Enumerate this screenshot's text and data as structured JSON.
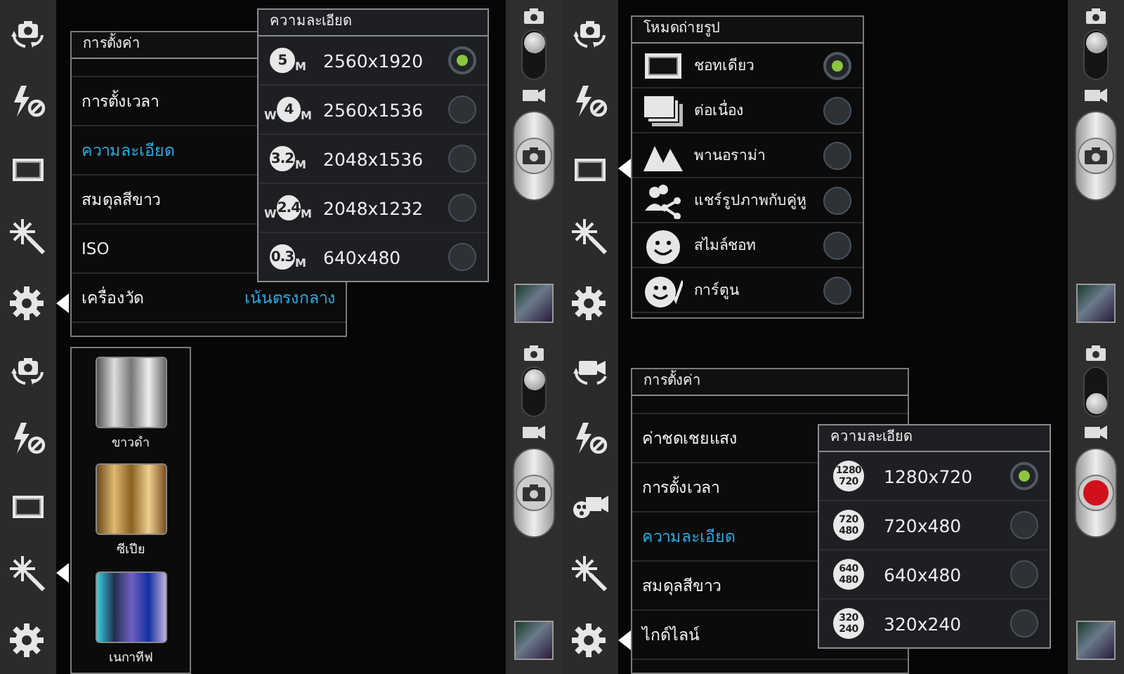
{
  "screens": [
    {
      "toolbar": [
        {
          "kind": "camera-switch",
          "selected": false
        },
        {
          "kind": "flash-off",
          "selected": false
        },
        {
          "kind": "single-shot",
          "selected": false
        },
        {
          "kind": "effects",
          "selected": false
        },
        {
          "kind": "settings",
          "selected": true
        }
      ],
      "settings_panel": {
        "title": "การตั้งค่า",
        "rows": [
          {
            "label": "การตั้งเวลา",
            "selected": false
          },
          {
            "label": "ความละเอียด",
            "selected": true
          },
          {
            "label": "สมดุลสีขาว",
            "selected": false
          },
          {
            "label": "ISO",
            "selected": false
          },
          {
            "label": "เครื่องวัด",
            "value": "เน้นตรงกลาง",
            "selected": false
          }
        ]
      },
      "popup": {
        "title": "ความละเอียด",
        "options": [
          {
            "badge": {
              "kind": "megapixel",
              "number": "5",
              "unit": "M"
            },
            "label": "2560x1920",
            "selected": true
          },
          {
            "badge": {
              "kind": "megapixel",
              "prefix": "W",
              "number": "4",
              "unit": "M"
            },
            "label": "2560x1536",
            "selected": false
          },
          {
            "badge": {
              "kind": "megapixel",
              "number": "3.2",
              "unit": "M"
            },
            "label": "2048x1536",
            "selected": false
          },
          {
            "badge": {
              "kind": "megapixel",
              "prefix": "W",
              "number": "2.4",
              "unit": "M"
            },
            "label": "2048x1232",
            "selected": false
          },
          {
            "badge": {
              "kind": "megapixel",
              "number": "0.3",
              "unit": "M"
            },
            "label": "640x480",
            "selected": false
          }
        ]
      }
    },
    {
      "left_rail": {
        "video": false
      },
      "toolbar": [
        {
          "kind": "camera-switch",
          "selected": false
        },
        {
          "kind": "flash-off",
          "selected": false
        },
        {
          "kind": "single-shot",
          "selected": true
        },
        {
          "kind": "effects",
          "selected": false
        },
        {
          "kind": "settings",
          "selected": false
        }
      ],
      "mode_panel": {
        "title": "โหมดถ่ายรูป",
        "options": [
          {
            "kind": "single",
            "label": "ชอทเดียว",
            "selected": true
          },
          {
            "kind": "continuous",
            "label": "ต่อเนื่อง",
            "selected": false
          },
          {
            "kind": "panorama",
            "label": "พานอราม่า",
            "selected": false
          },
          {
            "kind": "buddy-share",
            "label": "แชร์รูปภาพกับคู่หู",
            "selected": false
          },
          {
            "kind": "smile",
            "label": "สไมล์ชอท",
            "selected": false
          },
          {
            "kind": "cartoon",
            "label": "การ์ตูน",
            "selected": false
          }
        ]
      },
      "right_rail": {
        "video": false
      }
    },
    {
      "toolbar": [
        {
          "kind": "camera-switch",
          "selected": false
        },
        {
          "kind": "flash-off",
          "selected": false
        },
        {
          "kind": "single-shot",
          "selected": false
        },
        {
          "kind": "effects",
          "selected": true
        },
        {
          "kind": "settings",
          "selected": false
        }
      ],
      "effects_panel": {
        "items": [
          {
            "kind": "mono",
            "label": "ขาวดำ"
          },
          {
            "kind": "sepia",
            "label": "ซีเปีย"
          },
          {
            "kind": "negative",
            "label": "เนกาทีฟ"
          }
        ]
      }
    },
    {
      "left_rail": {
        "video": false
      },
      "toolbar": [
        {
          "kind": "video-switch",
          "selected": false
        },
        {
          "kind": "flash-off",
          "selected": false
        },
        {
          "kind": "video-mode",
          "selected": false
        },
        {
          "kind": "effects",
          "selected": false
        },
        {
          "kind": "settings",
          "selected": true
        }
      ],
      "settings_panel": {
        "title": "การตั้งค่า",
        "rows": [
          {
            "label": "ค่าชดเชยแสง",
            "selected": false
          },
          {
            "label": "การตั้งเวลา",
            "selected": false
          },
          {
            "label": "ความละเอียด",
            "selected": true
          },
          {
            "label": "สมดุลสีขาว",
            "selected": false
          },
          {
            "label": "ไกด์ไลน์",
            "selected": false
          }
        ]
      },
      "popup": {
        "title": "ความละเอียด",
        "options": [
          {
            "badge": {
              "kind": "stacked",
              "lines": [
                "1280",
                "720"
              ]
            },
            "label": "1280x720",
            "selected": true
          },
          {
            "badge": {
              "kind": "stacked",
              "lines": [
                "720",
                "480"
              ]
            },
            "label": "720x480",
            "selected": false
          },
          {
            "badge": {
              "kind": "stacked",
              "lines": [
                "640",
                "480"
              ]
            },
            "label": "640x480",
            "selected": false
          },
          {
            "badge": {
              "kind": "stacked",
              "lines": [
                "320",
                "240"
              ]
            },
            "label": "320x240",
            "selected": false
          }
        ]
      },
      "right_rail": {
        "video": true
      }
    }
  ]
}
